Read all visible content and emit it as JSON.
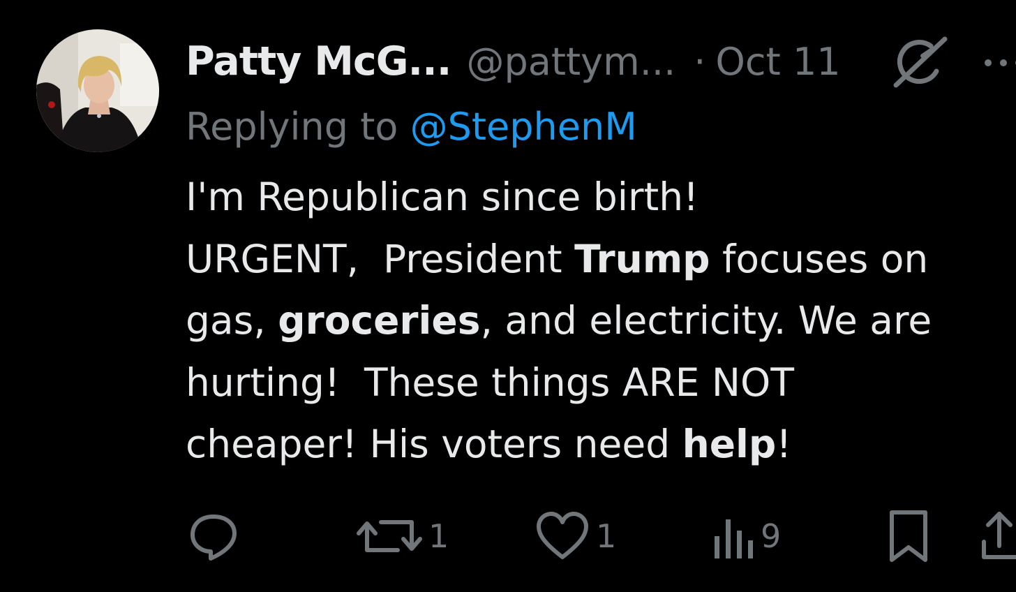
{
  "author": {
    "display_name": "Patty McG...",
    "handle": "@pattym...",
    "separator": "·",
    "date": "Oct 11"
  },
  "reply": {
    "prefix": "Replying to ",
    "mention": "@StephenM"
  },
  "tweet": {
    "line1": "I'm Republican since birth!",
    "line2_a": "URGENT,  President ",
    "line2_bold": "Trump",
    "line2_b": " focuses on",
    "line3_a": "gas, ",
    "line3_bold": "groceries",
    "line3_b": ", and electricity. We are",
    "line4": "hurting!  These things ARE NOT",
    "line5_a": "cheaper! His voters need ",
    "line5_bold": "help",
    "line5_b": "!"
  },
  "actions": {
    "reply_count": "",
    "repost_count": "1",
    "like_count": "1",
    "views_count": "9"
  },
  "icons": {
    "avatar": "avatar-photo",
    "grok": "grok-icon",
    "more": "more-dots-icon",
    "reply": "reply-bubble-icon",
    "repost": "repost-icon",
    "like": "heart-icon",
    "views": "views-bars-icon",
    "bookmark": "bookmark-icon",
    "share": "share-icon"
  },
  "colors": {
    "background": "#000000",
    "text": "#e7e9ea",
    "secondary": "#71767b",
    "link": "#1d9bf0"
  }
}
